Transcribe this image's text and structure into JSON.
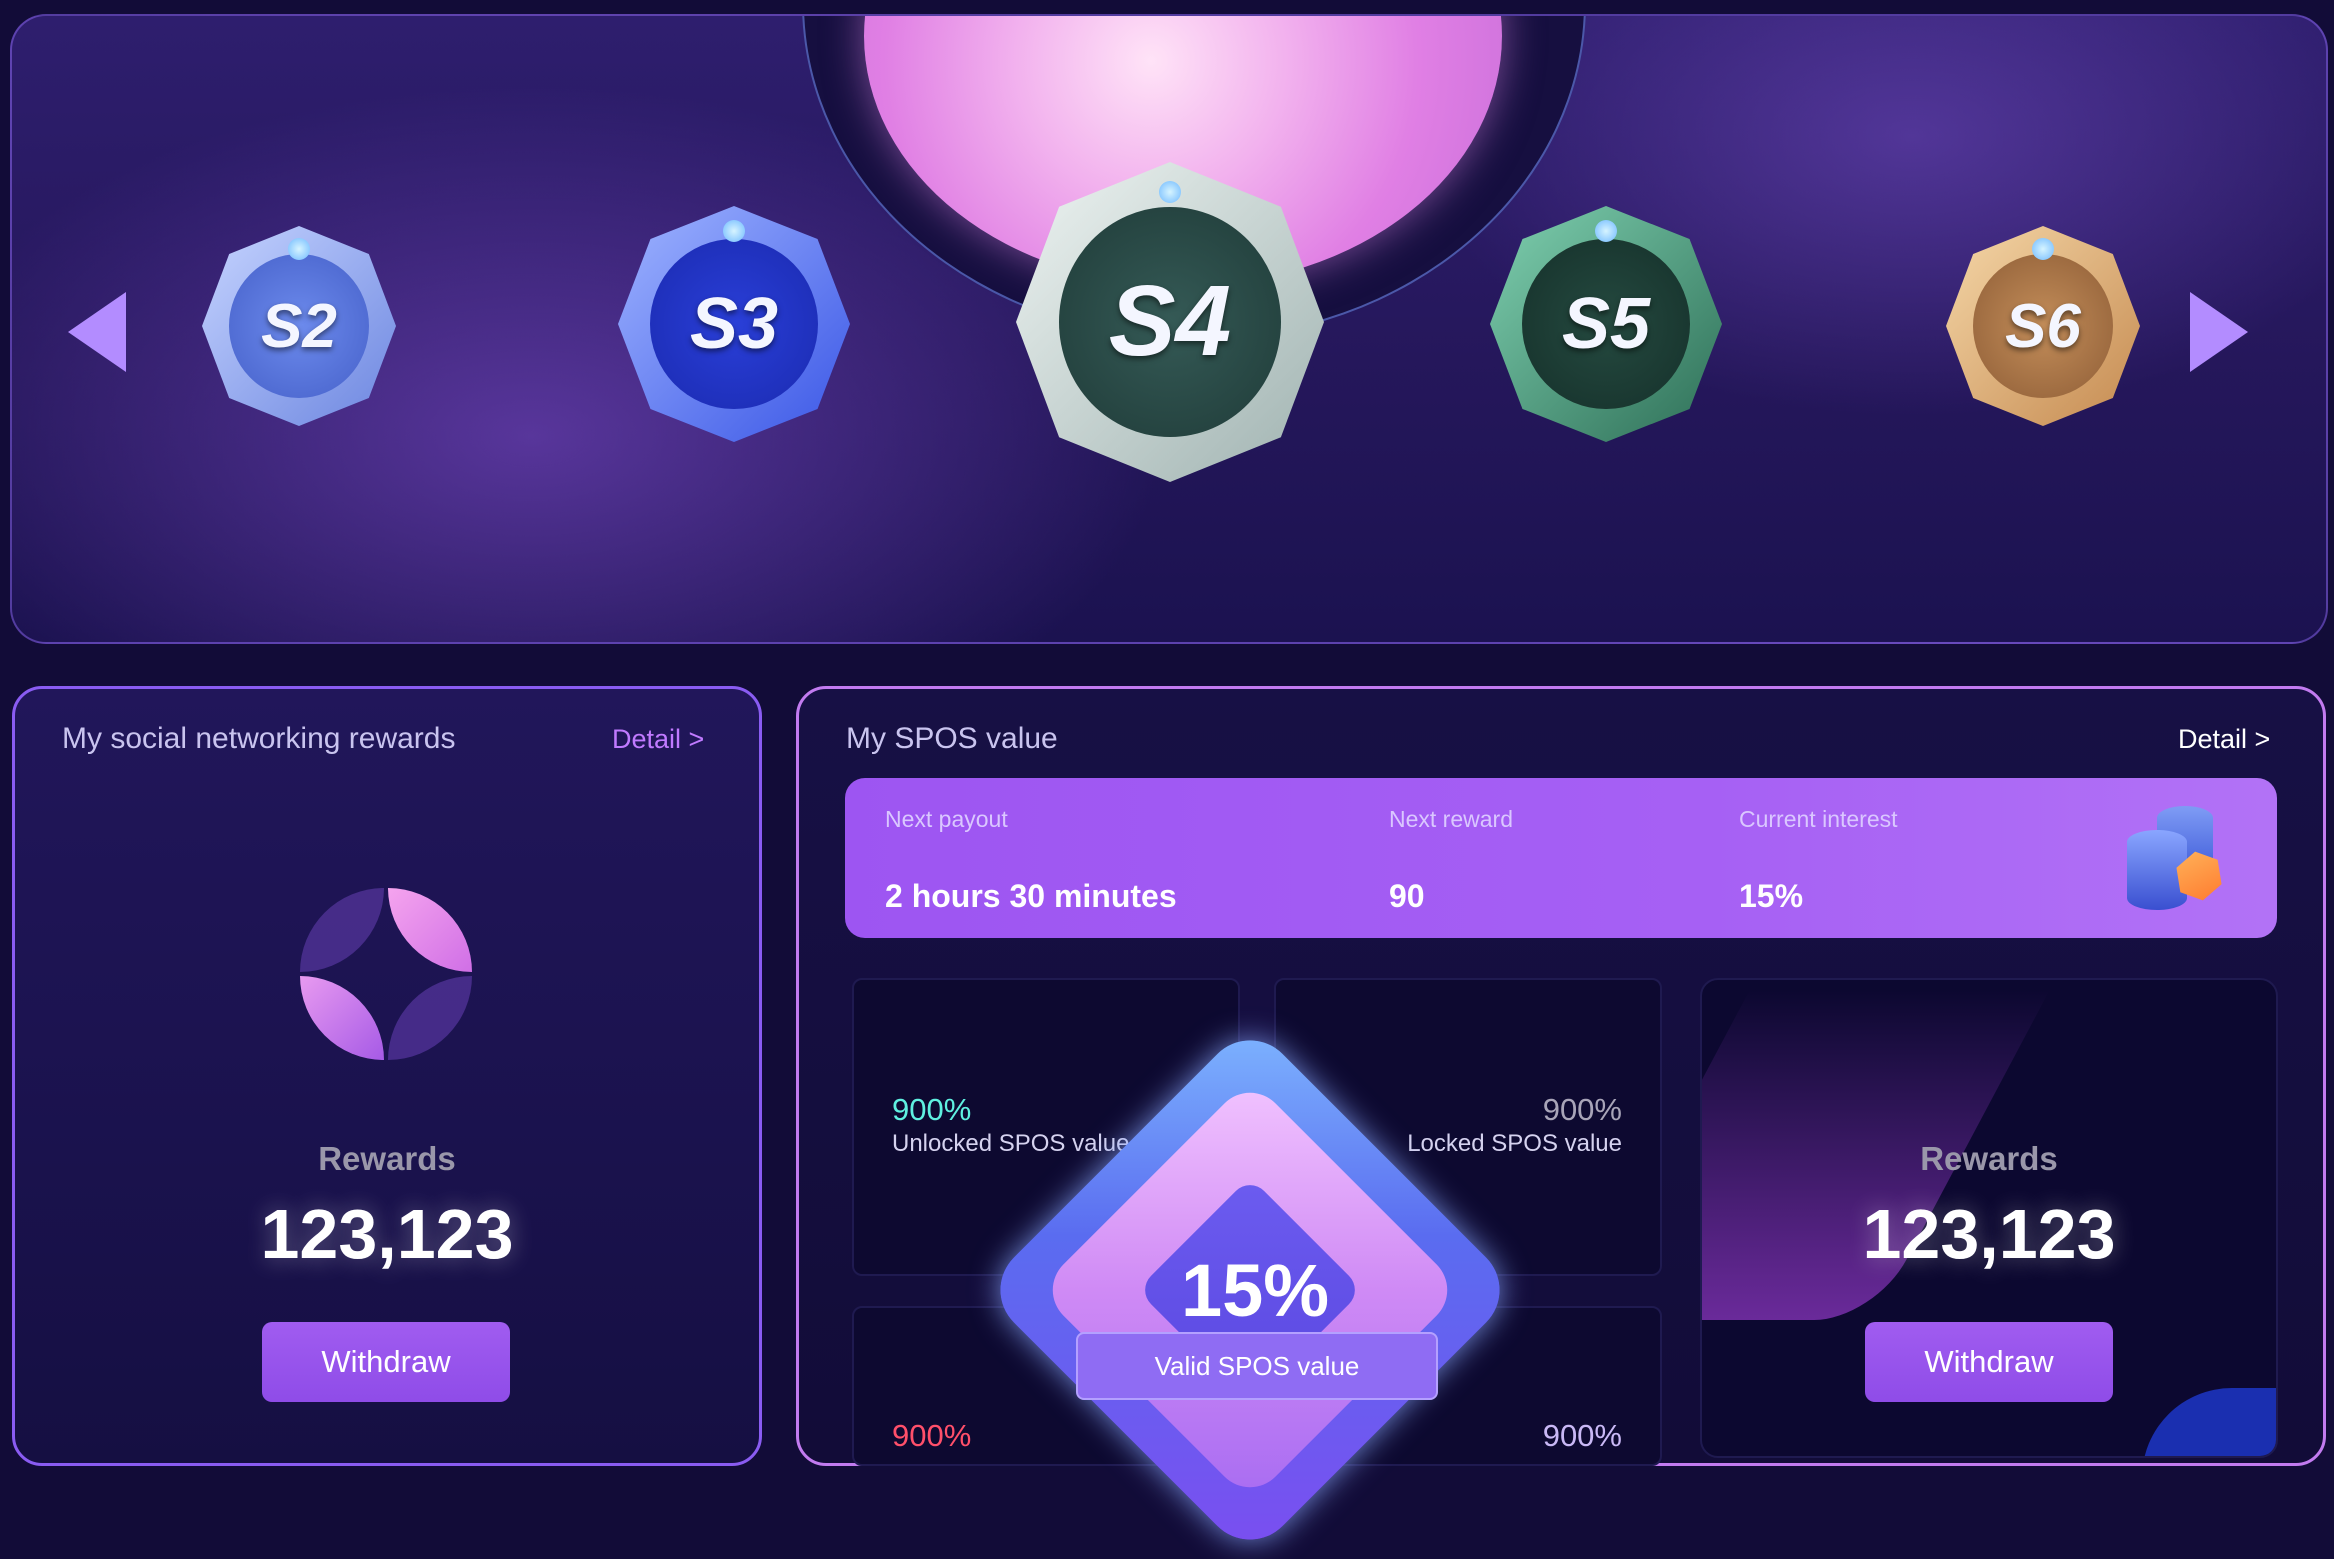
{
  "carousel": {
    "prev_arrow": "chevron-left-icon",
    "next_arrow": "chevron-right-icon",
    "badges": [
      {
        "label": "S2",
        "color": "#7d9cf0"
      },
      {
        "label": "S3",
        "color": "#2f48e0"
      },
      {
        "label": "S4",
        "color": "#b7c7c6"
      },
      {
        "label": "S5",
        "color": "#3f8a6e"
      },
      {
        "label": "S6",
        "color": "#d9a870"
      }
    ]
  },
  "social": {
    "title": "My social networking rewards",
    "detail_label": "Detail >",
    "rewards_label": "Rewards",
    "rewards_value": "123,123",
    "withdraw_label": "Withdraw"
  },
  "spos": {
    "title": "My SPOS value",
    "detail_label": "Detail >",
    "info": {
      "next_payout_label": "Next payout",
      "next_payout_value": "2 hours 30 minutes",
      "next_reward_label": "Next reward",
      "next_reward_value": "90",
      "current_interest_label": "Current interest",
      "current_interest_value": "15%"
    },
    "unlocked_pct": "900%",
    "unlocked_label": "Unlocked SPOS value",
    "locked_pct": "900%",
    "locked_label": "Locked SPOS value",
    "bottom_left_pct": "900%",
    "bottom_right_pct": "900%",
    "center_pct": "15%",
    "valid_label": "Valid SPOS value",
    "rewards_label": "Rewards",
    "rewards_value": "123,123",
    "withdraw_label": "Withdraw"
  },
  "colors": {
    "accent_purple": "#a05cf0",
    "unlocked_teal": "#5ff0e0",
    "bottom_left_red": "#ff4f6a",
    "locked_gray": "#a8a4b8",
    "detail_purple": "#c07aff"
  }
}
